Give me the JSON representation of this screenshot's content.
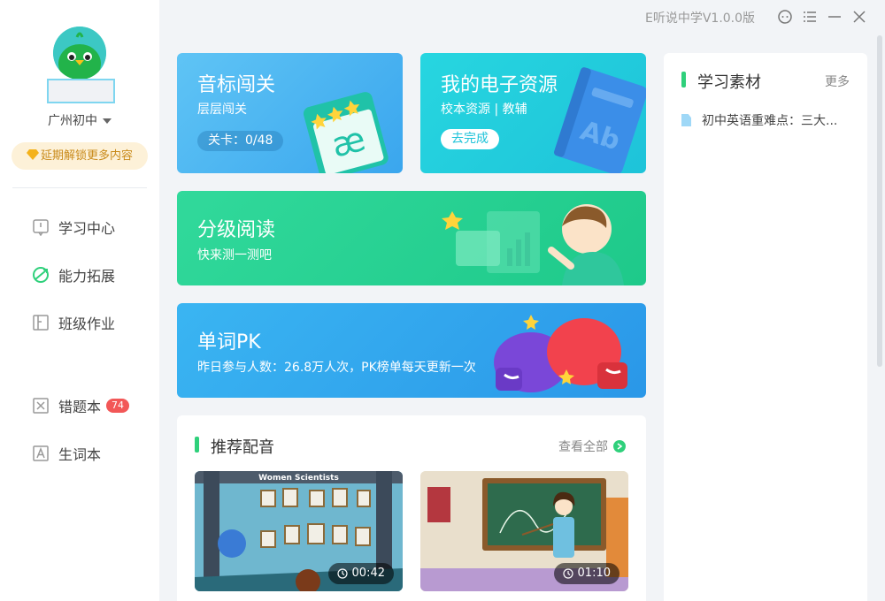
{
  "titlebar": {
    "version": "E听说中学V1.0.0版"
  },
  "sidebar": {
    "school": "广州初中",
    "unlock": "延期解锁更多内容",
    "nav": [
      {
        "label": "学习中心"
      },
      {
        "label": "能力拓展"
      },
      {
        "label": "班级作业"
      },
      {
        "label": "错题本",
        "badge": "74"
      },
      {
        "label": "生词本"
      }
    ]
  },
  "cards": {
    "yinbiao": {
      "title": "音标闯关",
      "sub": "层层闯关",
      "progress": "关卡：0/48"
    },
    "dianzi": {
      "title": "我的电子资源",
      "sub": "校本资源 | 教辅",
      "button": "去完成"
    },
    "fenji": {
      "title": "分级阅读",
      "sub": "快来测一测吧"
    },
    "pk": {
      "title": "单词PK",
      "sub": "昨日参与人数：26.8万人次，PK榜单每天更新一次"
    }
  },
  "recommend": {
    "title": "推荐配音",
    "more": "查看全部",
    "videos": [
      {
        "caption": "Women Scientists",
        "duration": "00:42"
      },
      {
        "duration": "01:10"
      }
    ]
  },
  "materials": {
    "title": "学习素材",
    "more": "更多",
    "items": [
      {
        "label": "初中英语重难点：三大..."
      }
    ]
  }
}
